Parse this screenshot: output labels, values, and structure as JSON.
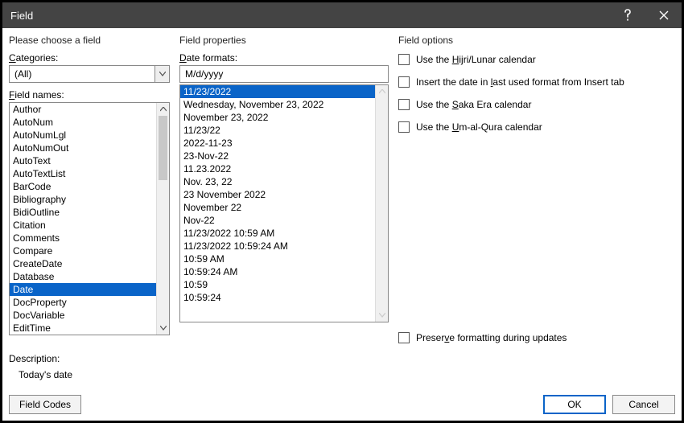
{
  "window": {
    "title": "Field"
  },
  "left": {
    "intro": "Please choose a field",
    "categories_label_pre": "C",
    "categories_label_post": "ategories:",
    "category_value": "(All)",
    "fieldnames_label_pre": "F",
    "fieldnames_label_post": "ield names:",
    "field_names": [
      "Author",
      "AutoNum",
      "AutoNumLgl",
      "AutoNumOut",
      "AutoText",
      "AutoTextList",
      "BarCode",
      "Bibliography",
      "BidiOutline",
      "Citation",
      "Comments",
      "Compare",
      "CreateDate",
      "Database",
      "Date",
      "DocProperty",
      "DocVariable",
      "EditTime"
    ],
    "selected_field_index": 14
  },
  "mid": {
    "header": "Field properties",
    "formats_label_pre": "D",
    "formats_label_post": "ate formats:",
    "format_value": "M/d/yyyy",
    "formats": [
      "11/23/2022",
      "Wednesday, November 23, 2022",
      "November 23, 2022",
      "11/23/22",
      "2022-11-23",
      "23-Nov-22",
      "11.23.2022",
      "Nov. 23, 22",
      "23 November 2022",
      "November 22",
      "Nov-22",
      "11/23/2022 10:59 AM",
      "11/23/2022 10:59:24 AM",
      "10:59 AM",
      "10:59:24 AM",
      "10:59",
      "10:59:24"
    ],
    "selected_format_index": 0
  },
  "right": {
    "header": "Field options",
    "opt1_pre": "Use the ",
    "opt1_u": "H",
    "opt1_post": "ijri/Lunar calendar",
    "opt2_pre": "Insert the date in ",
    "opt2_u": "l",
    "opt2_post": "ast used format from Insert tab",
    "opt3_pre": "Use the ",
    "opt3_u": "S",
    "opt3_post": "aka Era calendar",
    "opt4_pre": "Use the ",
    "opt4_u": "U",
    "opt4_post": "m-al-Qura calendar",
    "preserve_pre": "Preser",
    "preserve_u": "v",
    "preserve_post": "e formatting during updates"
  },
  "desc": {
    "label": "Description:",
    "text": "Today's date"
  },
  "buttons": {
    "fieldcodes": "Field Codes",
    "ok": "OK",
    "cancel": "Cancel"
  }
}
